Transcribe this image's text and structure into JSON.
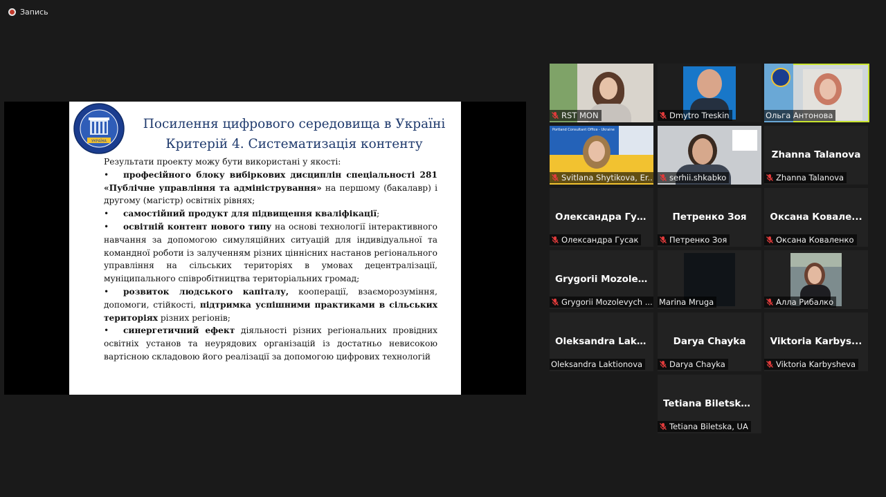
{
  "topbar": {
    "recording_label": "Запись"
  },
  "slide": {
    "logo_text": "УКРАЇНА",
    "title_line1": "Посилення цифрового середовища в Україні",
    "title_line2": "Критерій 4. Систематизація контенту",
    "intro": "Результати проекту можу бути використані у якості:",
    "bullet_char": "•",
    "b1_bold": "професійного блоку вибіркових дисциплін спеціальності 281 «Публічне управління та адміністрування»",
    "b1_rest": " на першому (бакалавр) і другому (магістр) освітніх рівнях;",
    "b2_bold": "самостійний продукт для підвищення кваліфікації",
    "b2_rest": ";",
    "b3_bold": "освітній контент нового типу",
    "b3_rest": " на основі технології інтерактивного навчання за допомогою симуляційних ситуацій для індивідуальної та командної роботи із залученням різних ціннісних настанов регіонального управління на сільських територіях в умовах децентралізації, муніципального співробітництва територіальних громад;",
    "b4_bold": "розвиток людського капіталу,",
    "b4_mid": " кооперації, взаєморозуміння, допомоги, стійкості, ",
    "b4_bold2": "підтримка успішними практиками в сільських територіях",
    "b4_rest": " різних регіонів;",
    "b5_bold": "синергетичний ефект",
    "b5_rest": " діяльності різних регіональних провідних освітніх установ та неурядових організацій із достатньо невисокою вартісною складовою його реалізації за допомогою цифрових технологій"
  },
  "participants": [
    {
      "label": "RST MON",
      "muted": true,
      "has_video": true
    },
    {
      "label": "Dmytro Treskin",
      "muted": true,
      "has_video": true
    },
    {
      "label": "Ольга Антонова",
      "muted": false,
      "has_video": true,
      "active": true
    },
    {
      "label": "Svitlana Shytikova, Er...",
      "muted": true,
      "has_video": true,
      "banner": "Portland Consultant Office - Ukraine"
    },
    {
      "label": "serhii.shkabko",
      "muted": true,
      "has_video": true
    },
    {
      "name": "Zhanna Talanova",
      "label": "Zhanna Talanova",
      "muted": true
    },
    {
      "name": "Олександра Гус...",
      "label": "Олександра Гусак",
      "muted": true
    },
    {
      "name": "Петренко Зоя",
      "label": "Петренко Зоя",
      "muted": true
    },
    {
      "name": "Оксана Ковале...",
      "label": "Оксана Коваленко",
      "muted": true
    },
    {
      "name": "Grygorii Mozole...",
      "label": "Grygorii Mozolevych ...",
      "muted": true
    },
    {
      "label": "Marina Mruga",
      "muted": false,
      "has_video": true
    },
    {
      "label": "Алла Рибалко",
      "muted": true,
      "has_video": true
    },
    {
      "name": "Oleksandra Lakt...",
      "label": "Oleksandra Laktionova",
      "muted": false
    },
    {
      "name": "Darya Chayka",
      "label": "Darya Chayka",
      "muted": true
    },
    {
      "name": "Viktoria Karbys...",
      "label": "Viktoria Karbysheva",
      "muted": true
    },
    {
      "name": "Tetiana Biletska,...",
      "label": "Tetiana Biletska, UA",
      "muted": true
    }
  ]
}
